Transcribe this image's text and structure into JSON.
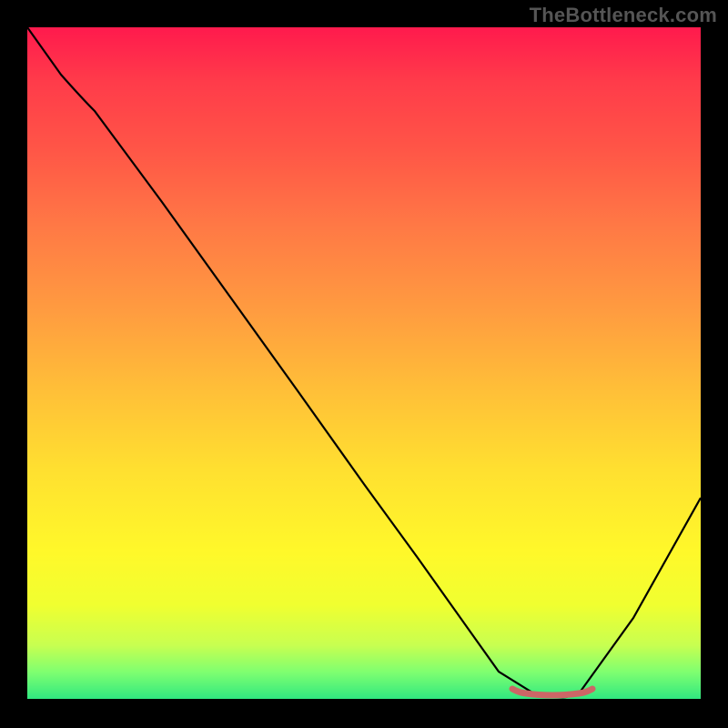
{
  "watermark": "TheBottleneck.com",
  "chart_data": {
    "type": "line",
    "title": "",
    "xlabel": "",
    "ylabel": "",
    "xlim": [
      0,
      100
    ],
    "ylim": [
      0,
      100
    ],
    "grid": false,
    "legend": false,
    "series": [
      {
        "name": "bottleneck-curve",
        "color": "#000000",
        "x": [
          0,
          5,
          10,
          20,
          30,
          40,
          50,
          58,
          63,
          70,
          75,
          78,
          82,
          90,
          100
        ],
        "y": [
          100,
          93,
          88,
          74,
          60,
          46,
          32,
          21,
          14,
          4,
          1,
          0,
          1,
          12,
          30
        ]
      },
      {
        "name": "optimal-range-marker",
        "color": "#d46a6a",
        "x": [
          72,
          74,
          76,
          78,
          80,
          82,
          84
        ],
        "y": [
          1.5,
          0.8,
          0.6,
          0.5,
          0.6,
          0.8,
          1.5
        ]
      }
    ],
    "background_gradient": {
      "top": "#ff1a4d",
      "mid_upper": "#ff9b40",
      "mid_lower": "#fff82a",
      "bottom": "#30e880"
    }
  }
}
